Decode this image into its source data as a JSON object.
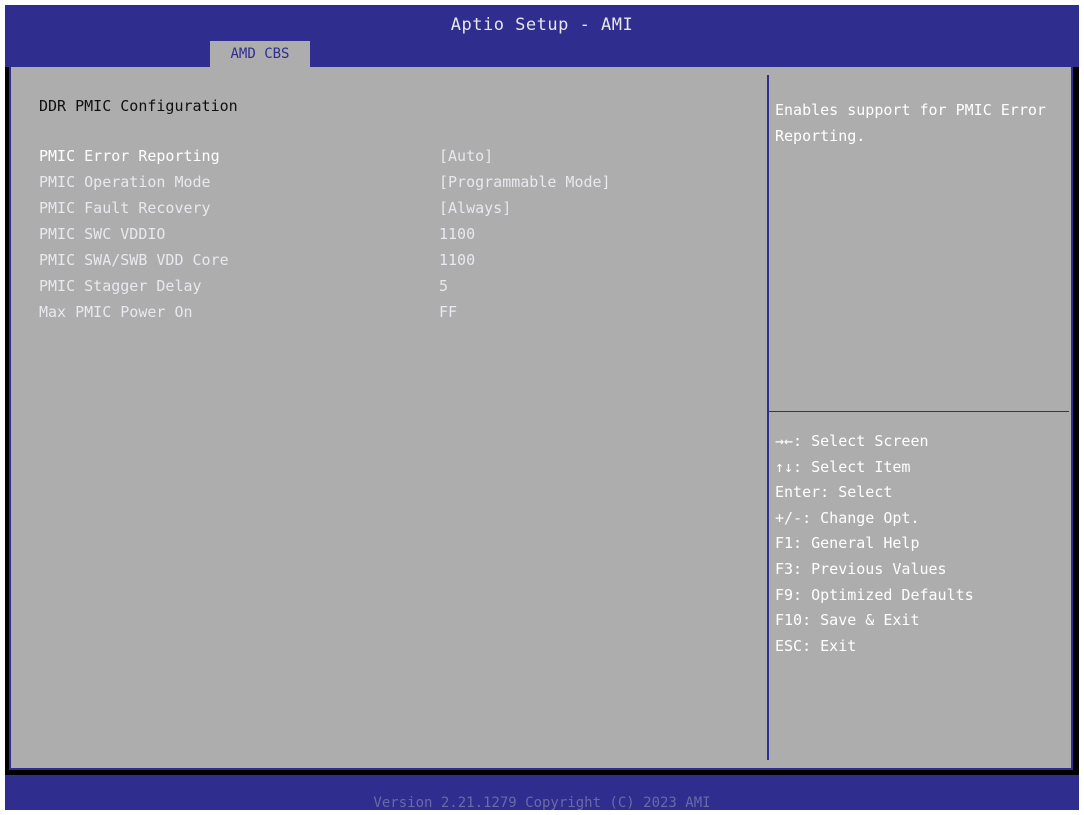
{
  "header": {
    "title": "Aptio Setup - AMI",
    "tab": "AMD CBS"
  },
  "main": {
    "section_title": "DDR PMIC Configuration",
    "settings": [
      {
        "label": "PMIC Error Reporting",
        "value": "[Auto]"
      },
      {
        "label": "PMIC Operation Mode",
        "value": "[Programmable Mode]"
      },
      {
        "label": "PMIC Fault Recovery",
        "value": "[Always]"
      },
      {
        "label": "PMIC SWC VDDIO",
        "value": "1100"
      },
      {
        "label": "PMIC SWA/SWB VDD Core",
        "value": "1100"
      },
      {
        "label": "PMIC Stagger Delay",
        "value": "5"
      },
      {
        "label": "Max PMIC Power On",
        "value": "FF"
      }
    ]
  },
  "help": {
    "text": "Enables support for PMIC Error Reporting.",
    "keys": [
      "→←: Select Screen",
      "↑↓: Select Item",
      "Enter: Select",
      "+/-: Change Opt.",
      "F1: General Help",
      "F3: Previous Values",
      "F9: Optimized Defaults",
      "F10: Save & Exit",
      "ESC: Exit"
    ]
  },
  "footer": {
    "text": "Version 2.21.1279 Copyright (C) 2023 AMI"
  },
  "colors": {
    "bar_blue": "#2f2d8e",
    "panel_gray": "#adadad",
    "text_white": "#ffffff"
  }
}
